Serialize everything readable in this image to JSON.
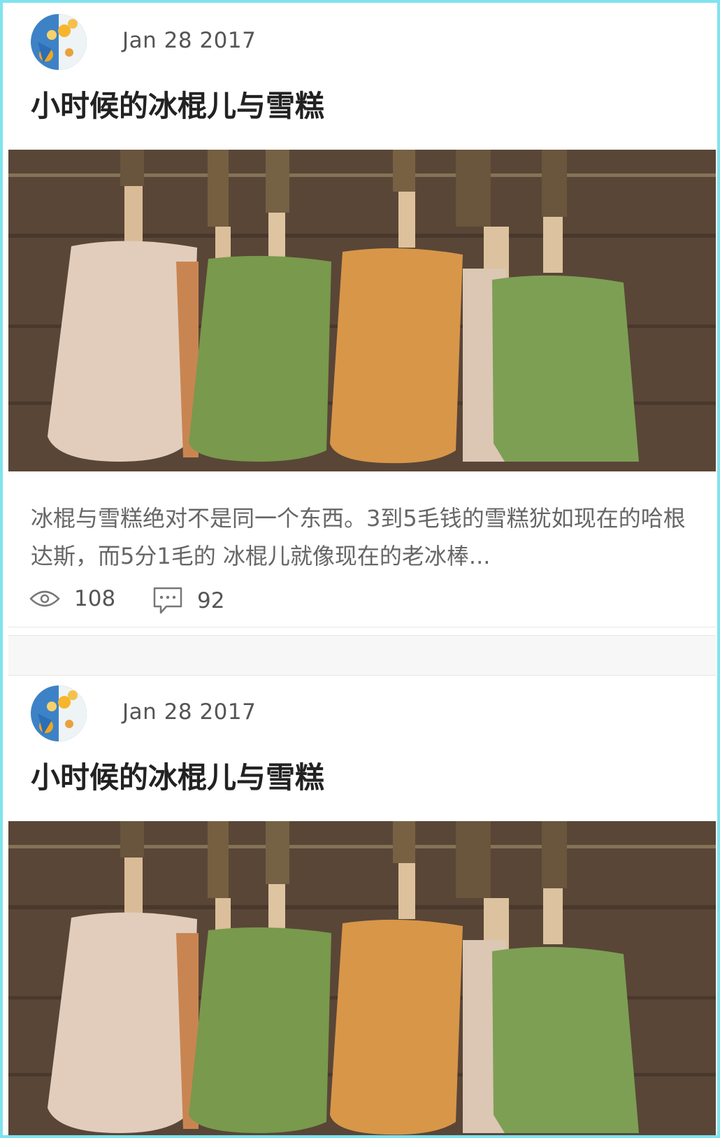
{
  "posts": [
    {
      "date": "Jan 28 2017",
      "title": "小时候的冰棍儿与雪糕",
      "cover_alt": "冰棍儿",
      "excerpt": "冰棍与雪糕绝对不是同一个东西。3到5毛钱的雪糕犹如现在的哈根达斯，而5分1毛的 冰棍儿就像现在的老冰棒...",
      "views": "108",
      "comments": "92"
    },
    {
      "date": "Jan 28 2017",
      "title": "小时候的冰棍儿与雪糕",
      "cover_alt": "冰棍儿"
    }
  ],
  "icons": {
    "views": "eye-icon",
    "comments": "comment-icon"
  },
  "colors": {
    "border_accent": "#7fe3ee",
    "title": "#222222",
    "meta": "#555555"
  }
}
